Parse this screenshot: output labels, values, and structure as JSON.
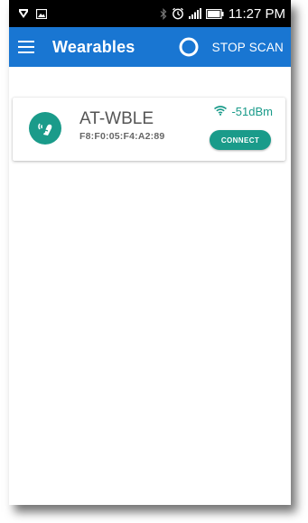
{
  "status_bar": {
    "time": "11:27 PM",
    "icons": [
      "notification-icon",
      "image-icon",
      "bluetooth-icon",
      "alarm-icon",
      "signal-icon",
      "battery-icon"
    ]
  },
  "app_bar": {
    "title": "Wearables",
    "menu_icon": "menu-icon",
    "scan_indicator": "scan-progress-icon",
    "stop_scan_label": "STOP SCAN",
    "color": "#1976d2"
  },
  "devices": [
    {
      "name": "AT-WBLE",
      "mac": "F8:F0:05:F4:A2:89",
      "rssi": "-51dBm",
      "icon": "wearable-device-icon",
      "connect_label": "CONNECT",
      "accent": "#1a9b8a"
    }
  ]
}
